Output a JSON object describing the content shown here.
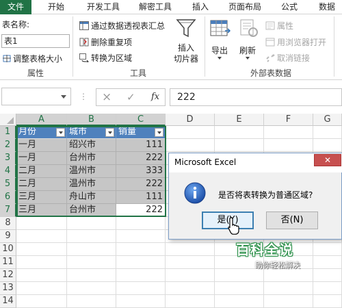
{
  "tabs": [
    "文件",
    "开始",
    "开发工具",
    "解密工具",
    "插入",
    "页面布局",
    "公式",
    "数据"
  ],
  "ribbon": {
    "table_name_label": "表名称:",
    "table_name_value": "表1",
    "resize_table": "调整表格大小",
    "group_properties": "属性",
    "summarize_pivot": "通过数据透视表汇总",
    "remove_duplicates": "删除重复项",
    "convert_to_range": "转换为区域",
    "insert_slicer_l1": "插入",
    "insert_slicer_l2": "切片器",
    "group_tools": "工具",
    "export": "导出",
    "refresh": "刷新",
    "properties": "属性",
    "open_in_browser": "用浏览器打开",
    "unlink": "取消链接",
    "group_external": "外部表数据"
  },
  "formula_bar": {
    "cancel_icon": "×",
    "confirm_icon": "✓",
    "fx": "fx",
    "value": "222"
  },
  "grid": {
    "columns": [
      "A",
      "B",
      "C",
      "D",
      "E",
      "F",
      "G"
    ],
    "rows": [
      "1",
      "2",
      "3",
      "4",
      "5",
      "6",
      "7",
      "8",
      "9",
      "10",
      "11",
      "12",
      "13",
      "14"
    ],
    "headers": [
      "月份",
      "城市",
      "销量"
    ],
    "data": [
      [
        "一月",
        "绍兴市",
        "111"
      ],
      [
        "一月",
        "台州市",
        "222"
      ],
      [
        "二月",
        "温州市",
        "333"
      ],
      [
        "二月",
        "温州市",
        "222"
      ],
      [
        "三月",
        "舟山市",
        "111"
      ],
      [
        "三月",
        "台州市",
        "222"
      ]
    ]
  },
  "dialog": {
    "title": "Microsoft Excel",
    "message": "是否将表转换为普通区域?",
    "yes": "是(Y)",
    "no": "否(N)",
    "icon": "info-icon"
  },
  "watermark": {
    "line1": "百科全说",
    "line2": "助你轻松解决"
  },
  "colors": {
    "excel_green": "#217346",
    "table_header": "#4f81bd",
    "dialog_border": "#7a9cc6"
  }
}
